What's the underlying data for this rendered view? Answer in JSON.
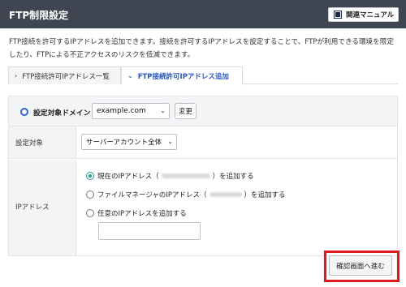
{
  "header": {
    "title": "FTP制限設定",
    "manual_label": "関連マニュアル",
    "manual_icon": "book-icon"
  },
  "description": [
    "FTP接続を許可するIPアドレスを追加できます。接続を許可するIPアドレスを設定することで、FTPが利用できる環境を限定",
    "したり、FTPによる不正アクセスのリスクを低減できます。"
  ],
  "tabs": [
    {
      "label": "FTP接続許可IPアドレス一覧",
      "chevron": "›",
      "active": false
    },
    {
      "label": "FTP接続許可IPアドレス追加",
      "chevron": "⌄",
      "active": true
    }
  ],
  "domain": {
    "label": "設定対象ドメイン",
    "value": "example.com",
    "change_label": "変更"
  },
  "form": {
    "target_label": "設定対象",
    "target_value": "サーバーアカウント全体",
    "ip_label": "IPアドレス",
    "options": [
      {
        "pre": "現在のIPアドレス（",
        "post": "）を追加する",
        "selected": true
      },
      {
        "pre": "ファイルマネージャのIPアドレス（",
        "post": "）を追加する",
        "selected": false
      },
      {
        "pre": "任意のIPアドレスを追加する",
        "post": "",
        "selected": false
      }
    ],
    "custom_ip_value": ""
  },
  "confirm_label": "確認画面へ進む",
  "colors": {
    "header_bg": "#3f4652",
    "active_tab": "#2657c9",
    "radio_selected": "#1aa39a",
    "highlight": "#e0191f"
  }
}
